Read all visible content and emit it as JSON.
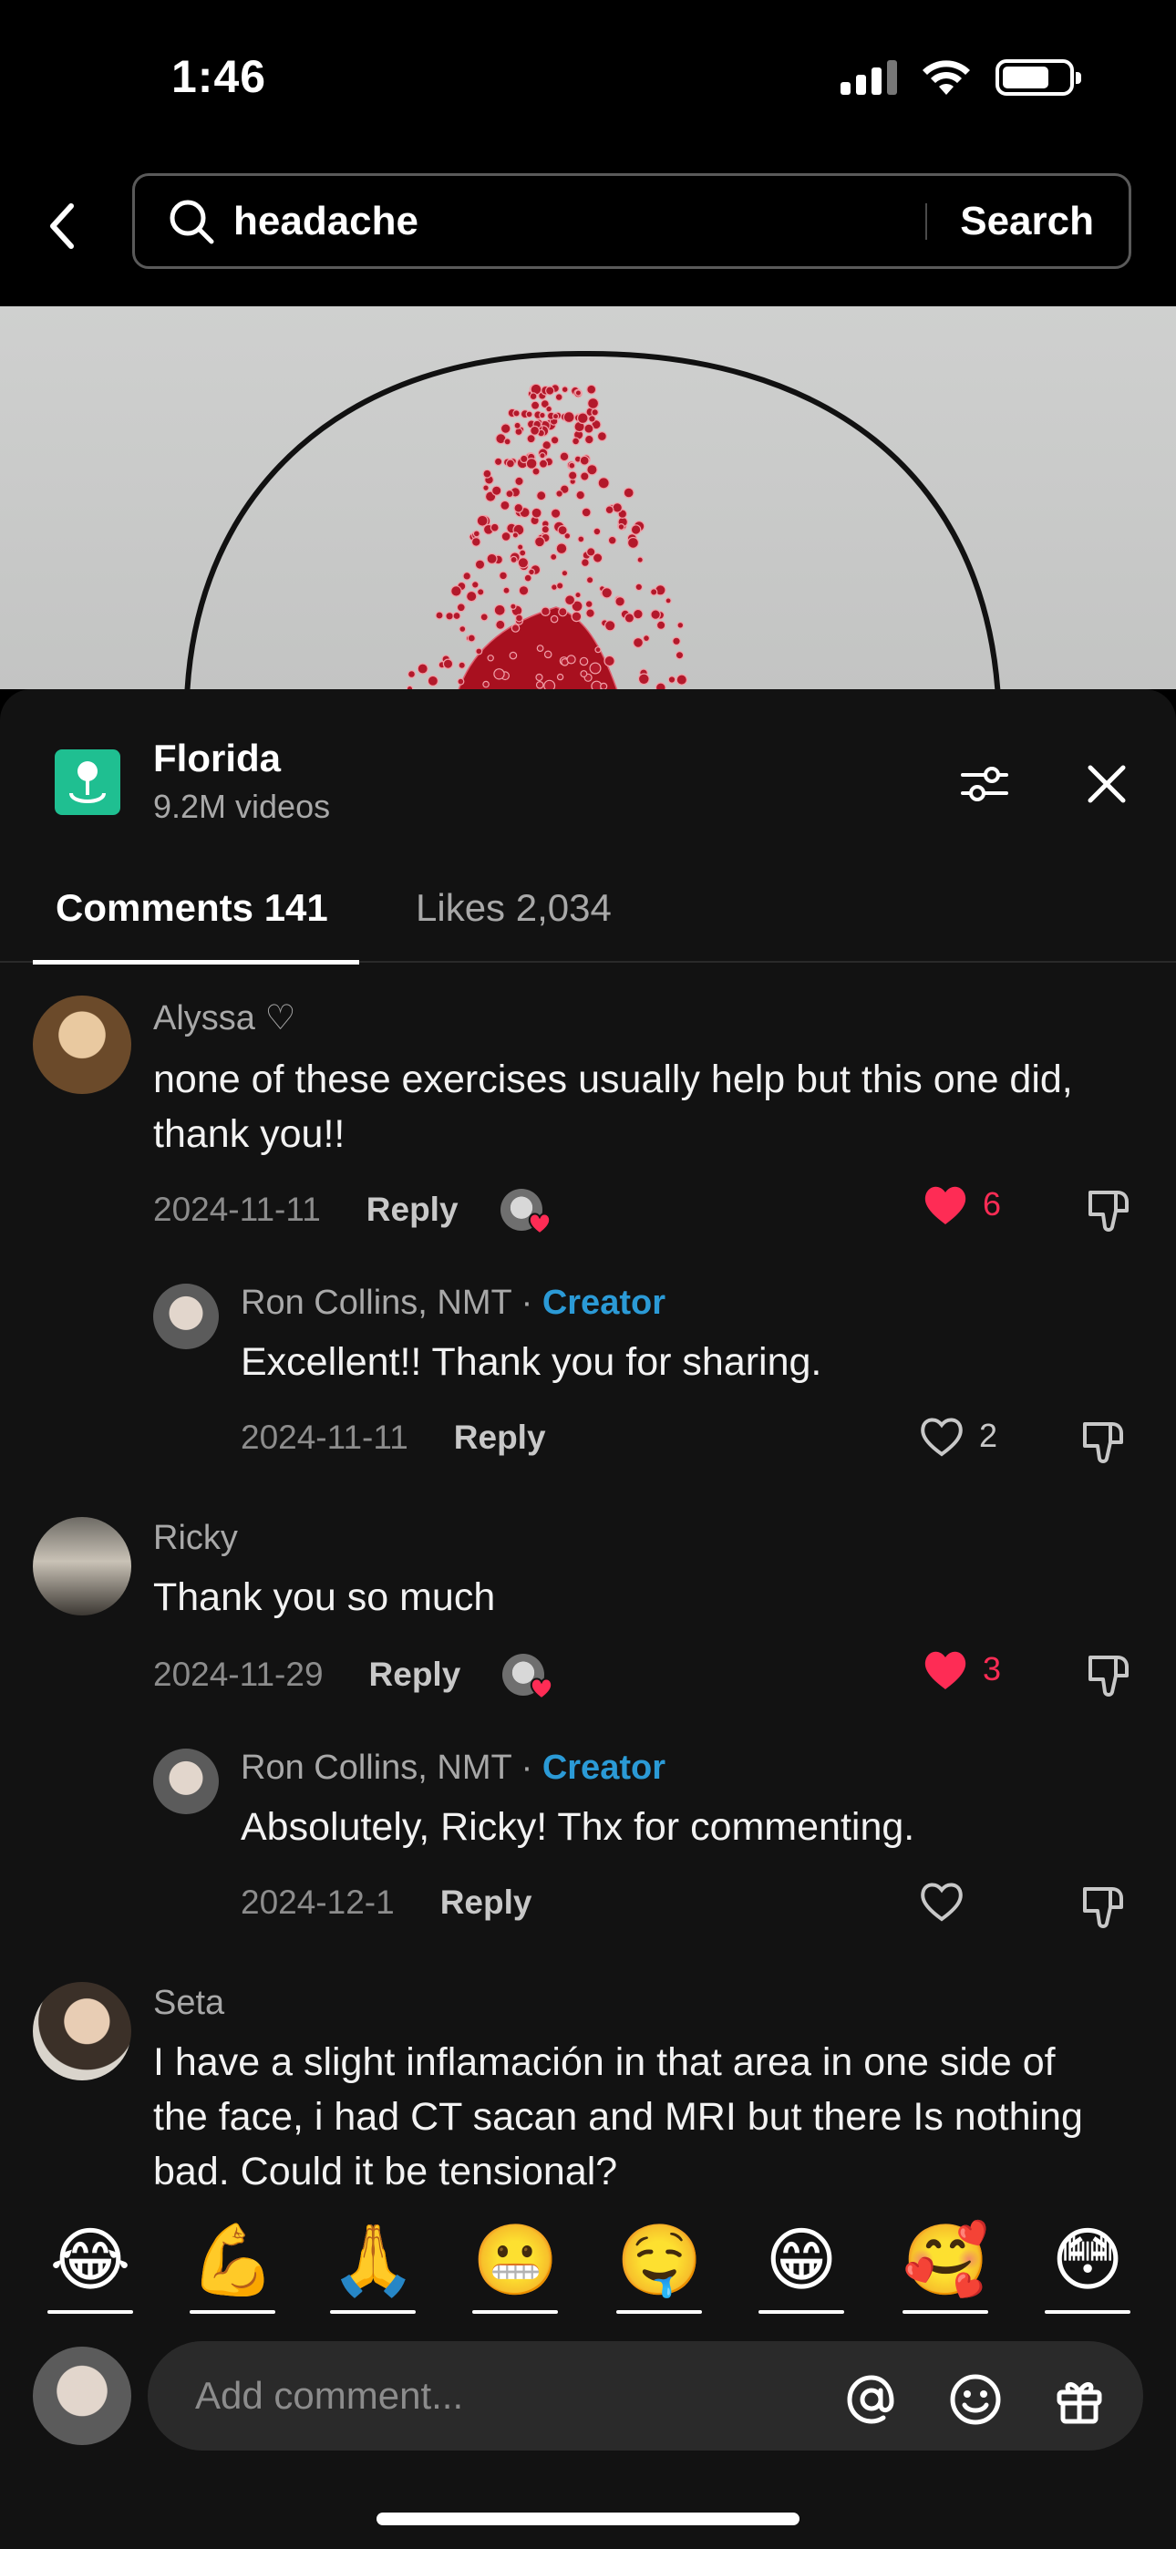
{
  "status": {
    "time": "1:46"
  },
  "search": {
    "query": "headache",
    "button": "Search"
  },
  "sheet": {
    "location": {
      "title": "Florida",
      "subtitle": "9.2M videos"
    },
    "tabs": {
      "comments": "Comments 141",
      "likes": "Likes 2,034"
    }
  },
  "comments": [
    {
      "user": "Alyssa ♡",
      "text": "none of these exercises usually help but this one did, thank you!!",
      "date": "2024-11-11",
      "reply": "Reply",
      "likes": "6",
      "replies": [
        {
          "user": "Ron Collins, NMT ·",
          "badge": "Creator",
          "text": "Excellent!! Thank you for sharing.",
          "date": "2024-11-11",
          "reply": "Reply",
          "likes": "2"
        }
      ]
    },
    {
      "user": "Ricky",
      "text": "Thank you so much",
      "date": "2024-11-29",
      "reply": "Reply",
      "likes": "3",
      "replies": [
        {
          "user": "Ron Collins, NMT ·",
          "badge": "Creator",
          "text": "Absolutely, Ricky! Thx for commenting.",
          "date": "2024-12-1",
          "reply": "Reply",
          "likes": ""
        }
      ]
    },
    {
      "user": "Seta",
      "text": "I have a slight inflamación in that area in one side of the face, i had CT sacan and MRI but there Is nothing bad. Could it be tensional?"
    }
  ],
  "emojis": [
    "😂",
    "💪",
    "🙏",
    "😬",
    "🤤",
    "😁",
    "🥰",
    "😳"
  ],
  "input": {
    "placeholder": "Add comment..."
  },
  "colors": {
    "accent_red": "#fe2c55",
    "creator_blue": "#2b9ad6",
    "location_green": "#1fbf91"
  }
}
